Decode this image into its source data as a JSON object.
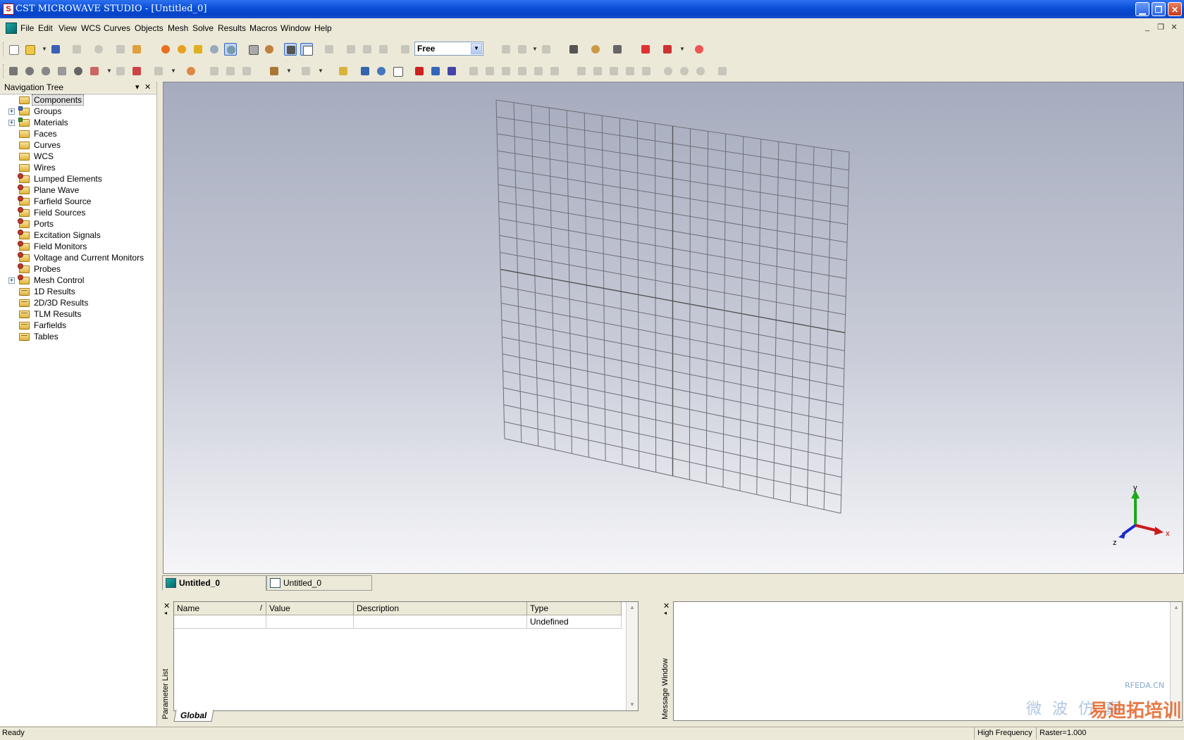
{
  "window": {
    "title": "CST MICROWAVE STUDIO - [Untitled_0]"
  },
  "menu": [
    "File",
    "Edit",
    "View",
    "WCS",
    "Curves",
    "Objects",
    "Mesh",
    "Solve",
    "Results",
    "Macros",
    "Window",
    "Help"
  ],
  "toolbar": {
    "selection_mode_value": "Free"
  },
  "navigation_tree": {
    "title": "Navigation Tree",
    "items": [
      {
        "label": "Components",
        "expandable": false,
        "icon": "folder-icon",
        "selected": true
      },
      {
        "label": "Groups",
        "expandable": true,
        "icon": "folder-group-icon"
      },
      {
        "label": "Materials",
        "expandable": true,
        "icon": "folder-material-icon"
      },
      {
        "label": "Faces",
        "expandable": false,
        "icon": "folder-icon"
      },
      {
        "label": "Curves",
        "expandable": false,
        "icon": "folder-icon"
      },
      {
        "label": "WCS",
        "expandable": false,
        "icon": "folder-icon"
      },
      {
        "label": "Wires",
        "expandable": false,
        "icon": "folder-icon"
      },
      {
        "label": "Lumped Elements",
        "expandable": false,
        "icon": "folder-source-icon"
      },
      {
        "label": "Plane Wave",
        "expandable": false,
        "icon": "folder-source-icon"
      },
      {
        "label": "Farfield Source",
        "expandable": false,
        "icon": "folder-source-icon"
      },
      {
        "label": "Field Sources",
        "expandable": false,
        "icon": "folder-source-icon"
      },
      {
        "label": "Ports",
        "expandable": false,
        "icon": "folder-source-icon"
      },
      {
        "label": "Excitation Signals",
        "expandable": false,
        "icon": "folder-source-icon"
      },
      {
        "label": "Field Monitors",
        "expandable": false,
        "icon": "folder-source-icon"
      },
      {
        "label": "Voltage and Current Monitors",
        "expandable": false,
        "icon": "folder-source-icon"
      },
      {
        "label": "Probes",
        "expandable": false,
        "icon": "folder-source-icon"
      },
      {
        "label": "Mesh Control",
        "expandable": true,
        "icon": "folder-source-icon"
      },
      {
        "label": "1D Results",
        "expandable": false,
        "icon": "folder-results-icon"
      },
      {
        "label": "2D/3D Results",
        "expandable": false,
        "icon": "folder-results-icon"
      },
      {
        "label": "TLM Results",
        "expandable": false,
        "icon": "folder-results-icon"
      },
      {
        "label": "Farfields",
        "expandable": false,
        "icon": "folder-results-icon"
      },
      {
        "label": "Tables",
        "expandable": false,
        "icon": "folder-results-icon"
      }
    ]
  },
  "viewport": {
    "axes": {
      "x": "x",
      "y": "y",
      "z": "z"
    }
  },
  "doc_tabs": [
    {
      "label": "Untitled_0",
      "active": true
    },
    {
      "label": "Untitled_0",
      "active": false
    }
  ],
  "parameter_list": {
    "side_label": "Parameter List",
    "columns": [
      "Name",
      "Value",
      "Description",
      "Type"
    ],
    "rows": [
      [
        "",
        "",
        "",
        "Undefined"
      ]
    ],
    "sheet_tab": "Global"
  },
  "message_window": {
    "side_label": "Message Window"
  },
  "status": {
    "left": "Ready",
    "mode": "High Frequency",
    "raster": "Raster=1.000"
  },
  "watermark": {
    "url": "RFEDA.CN",
    "chinese": "易迪拓培训",
    "chinese2": "微 波 仿 真"
  }
}
